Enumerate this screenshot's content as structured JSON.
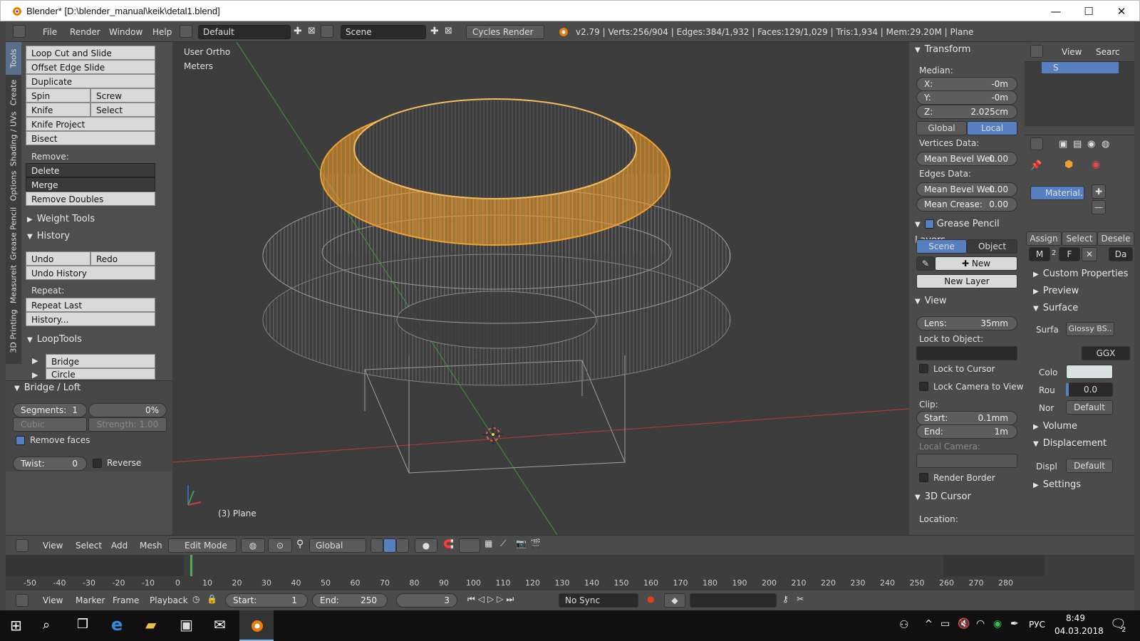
{
  "window": {
    "title": "Blender* [D:\\blender_manual\\keik\\detal1.blend]",
    "min": "—",
    "max": "☐",
    "close": "✕"
  },
  "info_header": {
    "menus": [
      "File",
      "Render",
      "Window",
      "Help"
    ],
    "screen_layout": "Default",
    "scene": "Scene",
    "render_engine": "Cycles Render",
    "stats": "v2.79 | Verts:256/904 | Edges:384/1,932 | Faces:129/1,029 | Tris:1,934 | Mem:29.20M | Plane"
  },
  "tool_tabs": [
    "Tools",
    "Create",
    "Shading / UVs",
    "Options",
    "Grease Pencil",
    "Measureit",
    "3D Printing"
  ],
  "tools": {
    "loop_cut": "Loop Cut and Slide",
    "offset_edge": "Offset Edge Slide",
    "duplicate": "Duplicate",
    "spin": "Spin",
    "screw": "Screw",
    "knife": "Knife",
    "select": "Select",
    "knife_project": "Knife Project",
    "bisect": "Bisect",
    "remove_label": "Remove:",
    "delete": "Delete",
    "merge": "Merge",
    "remove_doubles": "Remove Doubles",
    "weight_tools": "Weight Tools",
    "history": "History",
    "undo": "Undo",
    "redo": "Redo",
    "undo_history": "Undo History",
    "repeat_label": "Repeat:",
    "repeat_last": "Repeat Last",
    "history_dots": "History...",
    "looptools": "LoopTools",
    "bridge": "Bridge",
    "circle": "Circle"
  },
  "bridge_loft": {
    "title": "Bridge / Loft",
    "segments_label": "Segments:",
    "segments_value": "1",
    "percent": "0%",
    "interp": "Cubic",
    "strength": "Strength: 1.00",
    "remove_faces": "Remove faces",
    "twist_label": "Twist:",
    "twist_value": "0",
    "reverse": "Reverse"
  },
  "viewport": {
    "view_name": "User Ortho",
    "units": "Meters",
    "object": "(3) Plane"
  },
  "npanel": {
    "transform": "Transform",
    "median": "Median:",
    "x_label": "X:",
    "x_value": "-0m",
    "y_label": "Y:",
    "y_value": "-0m",
    "z_label": "Z:",
    "z_value": "2.025cm",
    "global": "Global",
    "local": "Local",
    "vertices_data": "Vertices Data:",
    "mean_bevel_label": "Mean Bevel Wei:",
    "mean_bevel_value": "0.00",
    "edges_data": "Edges Data:",
    "mean_bevel2_label": "Mean Bevel Wei:",
    "mean_bevel2_value": "0.00",
    "mean_crease_label": "Mean Crease:",
    "mean_crease_value": "0.00",
    "grease_pencil": "Grease Pencil Layers",
    "scene": "Scene",
    "object": "Object",
    "new": "New",
    "new_layer": "New Layer",
    "view": "View",
    "lens_label": "Lens:",
    "lens_value": "35mm",
    "lock_to_object": "Lock to Object:",
    "lock_to_cursor": "Lock to Cursor",
    "lock_camera": "Lock Camera to View",
    "clip": "Clip:",
    "start_label": "Start:",
    "start_value": "0.1mm",
    "end_label": "End:",
    "end_value": "1m",
    "local_camera": "Local Camera:",
    "render_border": "Render Border",
    "cursor": "3D Cursor",
    "location": "Location:"
  },
  "props": {
    "view": "View",
    "search": "Searc",
    "outliner_item": "S",
    "material": "Material.",
    "assign": "Assign",
    "select": "Select",
    "deselect": "Desele",
    "slot_m": "M",
    "slot_num": "2",
    "slot_f": "F",
    "slot_da": "Da",
    "custom_props": "Custom Properties",
    "preview": "Preview",
    "surface": "Surface",
    "surf_label": "Surfa",
    "surf_value": "Glossy BS..",
    "ggx": "GGX",
    "color_label": "Colo",
    "rough_label": "Rou",
    "rough_value": "0.0",
    "normal_label": "Nor",
    "normal_value": "Default",
    "volume": "Volume",
    "displacement": "Displacement",
    "displ_label": "Displ",
    "displ_value": "Default",
    "settings": "Settings"
  },
  "vp_header": {
    "view": "View",
    "select": "Select",
    "add": "Add",
    "mesh": "Mesh",
    "mode": "Edit Mode",
    "orientation": "Global"
  },
  "timeline": {
    "ticks": [
      "-50",
      "-40",
      "-30",
      "-20",
      "-10",
      "0",
      "10",
      "20",
      "30",
      "40",
      "50",
      "60",
      "70",
      "80",
      "90",
      "100",
      "110",
      "120",
      "130",
      "140",
      "150",
      "160",
      "170",
      "180",
      "190",
      "200",
      "210",
      "220",
      "230",
      "240",
      "250",
      "260",
      "270",
      "280"
    ],
    "current_frame": 3
  },
  "tl_header": {
    "view": "View",
    "marker": "Marker",
    "frame": "Frame",
    "playback": "Playback",
    "start_label": "Start:",
    "start_value": "1",
    "end_label": "End:",
    "end_value": "250",
    "current": "3",
    "sync": "No Sync"
  },
  "taskbar": {
    "lang": "РУС",
    "time": "8:49",
    "date": "04.03.2018",
    "notif": "2"
  },
  "colors": {
    "selection": "#f0a030",
    "accent": "#5680c2",
    "x_axis": "#c83c3c",
    "y_axis": "#3ca03c"
  }
}
